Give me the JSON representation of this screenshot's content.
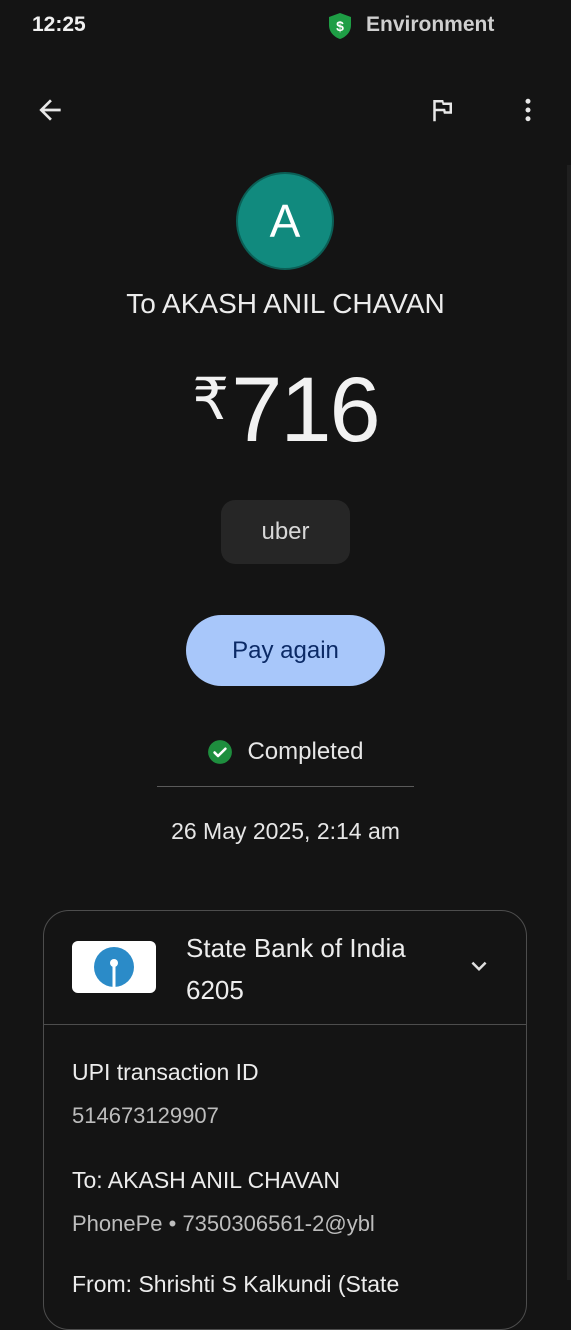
{
  "status_bar": {
    "time": "12:25",
    "env_label": "Environment",
    "icons": [
      "shield-dollar-icon"
    ]
  },
  "top_bar": {
    "icons": [
      "back-arrow-icon",
      "flag-icon",
      "more-vert-icon"
    ]
  },
  "payee": {
    "avatar_letter": "A",
    "title": "To AKASH ANIL CHAVAN"
  },
  "amount": {
    "currency": "₹",
    "value": "716"
  },
  "note": "uber",
  "pay_again_label": "Pay again",
  "status": {
    "text": "Completed",
    "color": "#1e8e3e"
  },
  "datetime": "26 May 2025, 2:14 am",
  "bank": {
    "name_line1": "State Bank of India",
    "name_line2": "6205",
    "logo": "sbi-logo"
  },
  "details": {
    "upi_label": "UPI transaction ID",
    "upi_value": "514673129907",
    "to_label": "To: AKASH ANIL CHAVAN",
    "to_value": "PhonePe • 7350306561-2@ybl",
    "from_partial": "From: Shrishti S Kalkundi (State"
  },
  "colors": {
    "background": "#141414",
    "accent": "#a8c7fa",
    "avatar": "#118a7e"
  }
}
